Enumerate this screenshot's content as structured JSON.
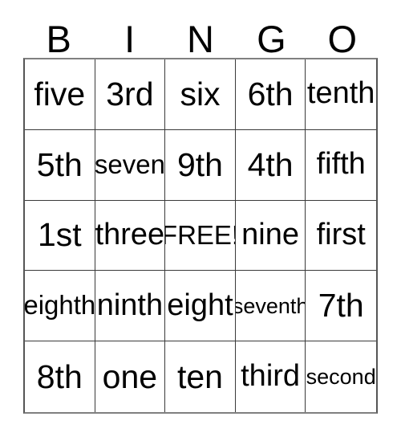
{
  "card": {
    "title": "BINGO",
    "free_space_label": "FREE!",
    "colors": {
      "background": "#ffffff",
      "text": "#000000",
      "grid_line": "#3a3a3a",
      "outer_border": "#808080"
    }
  },
  "header": {
    "letters": [
      {
        "label": "B"
      },
      {
        "label": "I"
      },
      {
        "label": "N"
      },
      {
        "label": "G"
      },
      {
        "label": "O"
      }
    ]
  },
  "grid": {
    "rows": 5,
    "columns": 5,
    "cells": [
      {
        "label": "five",
        "size": "t-xl",
        "free": false
      },
      {
        "label": "3rd",
        "size": "t-xl",
        "free": false
      },
      {
        "label": "six",
        "size": "t-xl",
        "free": false
      },
      {
        "label": "6th",
        "size": "t-xl",
        "free": false
      },
      {
        "label": "tenth",
        "size": "t-lg",
        "free": false
      },
      {
        "label": "5th",
        "size": "t-xl",
        "free": false
      },
      {
        "label": "seven",
        "size": "t-md",
        "free": false
      },
      {
        "label": "9th",
        "size": "t-xl",
        "free": false
      },
      {
        "label": "4th",
        "size": "t-xl",
        "free": false
      },
      {
        "label": "fifth",
        "size": "t-lg",
        "free": false
      },
      {
        "label": "1st",
        "size": "t-xl",
        "free": false
      },
      {
        "label": "three",
        "size": "t-lg",
        "free": false
      },
      {
        "label": "FREE!",
        "size": "t-md",
        "free": true
      },
      {
        "label": "nine",
        "size": "t-lg",
        "free": false
      },
      {
        "label": "first",
        "size": "t-lg",
        "free": false
      },
      {
        "label": "eighth",
        "size": "t-md",
        "free": false
      },
      {
        "label": "ninth",
        "size": "t-lg",
        "free": false
      },
      {
        "label": "eight",
        "size": "t-lg",
        "free": false
      },
      {
        "label": "seventh",
        "size": "t-sm",
        "free": false
      },
      {
        "label": "7th",
        "size": "t-xl",
        "free": false
      },
      {
        "label": "8th",
        "size": "t-xl",
        "free": false
      },
      {
        "label": "one",
        "size": "t-xl",
        "free": false
      },
      {
        "label": "ten",
        "size": "t-xl",
        "free": false
      },
      {
        "label": "third",
        "size": "t-lg",
        "free": false
      },
      {
        "label": "second",
        "size": "t-sm",
        "free": false
      }
    ]
  }
}
